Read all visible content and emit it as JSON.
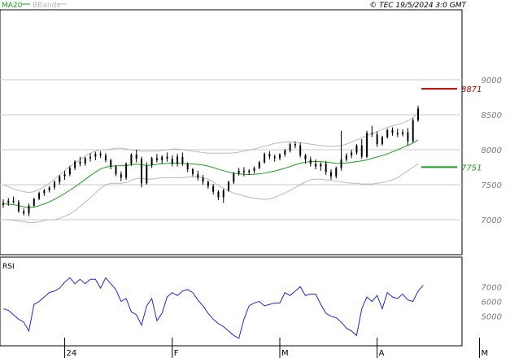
{
  "header": {
    "legend_ma": "MA20",
    "legend_bb": "BBands",
    "copyright": "© TEC 19/5/2024 3:0 GMT"
  },
  "rsi_label": "RSI",
  "colors": {
    "candles": "#000000",
    "ma20": "#1aa01a",
    "bbands": "#b8b8b8",
    "rsi": "#1e28d2",
    "resistance": "#b40000",
    "support": "#1aa01a",
    "grid": "#c8c8c8",
    "axis_text": "#7a7a7a"
  },
  "chart_data": [
    {
      "type": "candlestick",
      "title": "",
      "ylim": [
        6500,
        10000
      ],
      "yticks": [
        7000,
        7500,
        8000,
        8500,
        9000
      ],
      "ytick_labels": [
        "7000",
        "7500",
        "8000",
        "8500",
        "9000"
      ],
      "x_labels": [
        {
          "index": 12,
          "label": "24"
        },
        {
          "index": 33,
          "label": "F"
        },
        {
          "index": 54,
          "label": "M"
        },
        {
          "index": 73,
          "label": "A"
        },
        {
          "index": 93,
          "label": "M"
        }
      ],
      "levels": [
        {
          "name": "resistance",
          "value": 8871,
          "label": "8871"
        },
        {
          "name": "support",
          "value": 7751,
          "label": "7751"
        }
      ],
      "ohlc": [
        [
          7210,
          7290,
          7170,
          7240
        ],
        [
          7240,
          7310,
          7200,
          7270
        ],
        [
          7270,
          7330,
          7230,
          7250
        ],
        [
          7250,
          7280,
          7100,
          7120
        ],
        [
          7120,
          7160,
          7060,
          7090
        ],
        [
          7090,
          7230,
          7050,
          7200
        ],
        [
          7200,
          7310,
          7180,
          7300
        ],
        [
          7300,
          7400,
          7280,
          7380
        ],
        [
          7380,
          7440,
          7340,
          7420
        ],
        [
          7420,
          7480,
          7390,
          7460
        ],
        [
          7460,
          7560,
          7430,
          7540
        ],
        [
          7540,
          7640,
          7500,
          7620
        ],
        [
          7620,
          7700,
          7570,
          7650
        ],
        [
          7650,
          7770,
          7620,
          7740
        ],
        [
          7740,
          7850,
          7710,
          7830
        ],
        [
          7830,
          7900,
          7760,
          7800
        ],
        [
          7800,
          7900,
          7770,
          7880
        ],
        [
          7880,
          7950,
          7830,
          7900
        ],
        [
          7900,
          7970,
          7850,
          7940
        ],
        [
          7940,
          7980,
          7880,
          7920
        ],
        [
          7920,
          7950,
          7820,
          7850
        ],
        [
          7850,
          7870,
          7720,
          7760
        ],
        [
          7760,
          7780,
          7620,
          7650
        ],
        [
          7650,
          7690,
          7550,
          7600
        ],
        [
          7600,
          7820,
          7570,
          7800
        ],
        [
          7800,
          7950,
          7770,
          7930
        ],
        [
          7930,
          8000,
          7820,
          7870
        ],
        [
          7870,
          7900,
          7460,
          7520
        ],
        [
          7520,
          7820,
          7500,
          7780
        ],
        [
          7780,
          7900,
          7740,
          7880
        ],
        [
          7880,
          7940,
          7820,
          7850
        ],
        [
          7850,
          7920,
          7800,
          7900
        ],
        [
          7900,
          7960,
          7830,
          7870
        ],
        [
          7870,
          7920,
          7760,
          7800
        ],
        [
          7800,
          7940,
          7760,
          7900
        ],
        [
          7900,
          7960,
          7770,
          7800
        ],
        [
          7800,
          7820,
          7680,
          7720
        ],
        [
          7720,
          7740,
          7620,
          7650
        ],
        [
          7650,
          7700,
          7560,
          7600
        ],
        [
          7600,
          7640,
          7500,
          7540
        ],
        [
          7540,
          7560,
          7440,
          7480
        ],
        [
          7480,
          7510,
          7360,
          7400
        ],
        [
          7400,
          7420,
          7280,
          7320
        ],
        [
          7320,
          7440,
          7240,
          7420
        ],
        [
          7420,
          7560,
          7400,
          7540
        ],
        [
          7540,
          7680,
          7510,
          7660
        ],
        [
          7660,
          7740,
          7630,
          7700
        ],
        [
          7700,
          7750,
          7620,
          7680
        ],
        [
          7680,
          7720,
          7640,
          7700
        ],
        [
          7700,
          7760,
          7660,
          7740
        ],
        [
          7740,
          7840,
          7720,
          7820
        ],
        [
          7820,
          7960,
          7800,
          7940
        ],
        [
          7940,
          7980,
          7860,
          7900
        ],
        [
          7900,
          7930,
          7830,
          7880
        ],
        [
          7880,
          7950,
          7850,
          7930
        ],
        [
          7930,
          8010,
          7900,
          7990
        ],
        [
          7990,
          8100,
          7960,
          8080
        ],
        [
          8080,
          8120,
          8020,
          8060
        ],
        [
          8060,
          8100,
          7890,
          7920
        ],
        [
          7920,
          7940,
          7800,
          7860
        ],
        [
          7860,
          7900,
          7760,
          7800
        ],
        [
          7800,
          7860,
          7720,
          7760
        ],
        [
          7760,
          7820,
          7700,
          7800
        ],
        [
          7800,
          7840,
          7640,
          7680
        ],
        [
          7680,
          7720,
          7570,
          7620
        ],
        [
          7620,
          7760,
          7590,
          7740
        ],
        [
          7740,
          8270,
          7700,
          7860
        ],
        [
          7860,
          7950,
          7830,
          7920
        ],
        [
          7920,
          8000,
          7880,
          7960
        ],
        [
          7960,
          8080,
          7930,
          8060
        ],
        [
          8060,
          8150,
          7870,
          7900
        ],
        [
          7900,
          8270,
          7880,
          8240
        ],
        [
          8240,
          8340,
          8180,
          8220
        ],
        [
          8220,
          8260,
          8040,
          8080
        ],
        [
          8080,
          8200,
          8060,
          8180
        ],
        [
          8180,
          8300,
          8160,
          8280
        ],
        [
          8280,
          8320,
          8200,
          8240
        ],
        [
          8240,
          8300,
          8180,
          8220
        ],
        [
          8220,
          8290,
          8190,
          8250
        ],
        [
          8250,
          8310,
          8060,
          8120
        ],
        [
          8120,
          8450,
          8100,
          8420
        ],
        [
          8420,
          8630,
          8400,
          8590
        ]
      ],
      "ma20": [
        7230,
        7220,
        7215,
        7200,
        7185,
        7175,
        7180,
        7200,
        7225,
        7255,
        7290,
        7330,
        7375,
        7420,
        7470,
        7520,
        7575,
        7630,
        7680,
        7725,
        7750,
        7765,
        7770,
        7770,
        7775,
        7785,
        7795,
        7785,
        7775,
        7780,
        7790,
        7800,
        7805,
        7808,
        7808,
        7805,
        7800,
        7795,
        7790,
        7780,
        7765,
        7745,
        7720,
        7700,
        7680,
        7665,
        7655,
        7648,
        7645,
        7648,
        7655,
        7665,
        7680,
        7695,
        7715,
        7735,
        7760,
        7785,
        7805,
        7822,
        7832,
        7835,
        7830,
        7822,
        7815,
        7805,
        7805,
        7810,
        7820,
        7830,
        7840,
        7855,
        7875,
        7895,
        7915,
        7940,
        7970,
        8000,
        8030,
        8060,
        8095,
        8140
      ],
      "bb_upper": [
        7500,
        7470,
        7440,
        7420,
        7400,
        7390,
        7400,
        7430,
        7470,
        7520,
        7580,
        7640,
        7700,
        7760,
        7810,
        7860,
        7910,
        7950,
        7980,
        8000,
        8000,
        8010,
        8020,
        8020,
        8010,
        8000,
        7990,
        7980,
        7980,
        7980,
        7980,
        7990,
        8000,
        8010,
        8010,
        8000,
        7990,
        7980,
        7970,
        7960,
        7950,
        7950,
        7950,
        7950,
        7950,
        7955,
        7965,
        7980,
        7995,
        8010,
        8030,
        8050,
        8070,
        8090,
        8100,
        8110,
        8110,
        8105,
        8100,
        8090,
        8080,
        8070,
        8060,
        8050,
        8050,
        8050,
        8060,
        8080,
        8110,
        8140,
        8170,
        8200,
        8230,
        8260,
        8290,
        8320,
        8340,
        8360,
        8380,
        8410,
        8460,
        8530
      ],
      "bb_lower": [
        7000,
        7000,
        6990,
        6980,
        6970,
        6960,
        6960,
        6970,
        6990,
        7000,
        7000,
        7020,
        7050,
        7080,
        7130,
        7190,
        7250,
        7310,
        7380,
        7450,
        7500,
        7520,
        7520,
        7520,
        7530,
        7560,
        7590,
        7590,
        7580,
        7580,
        7590,
        7600,
        7600,
        7600,
        7600,
        7600,
        7610,
        7610,
        7610,
        7600,
        7580,
        7540,
        7490,
        7450,
        7410,
        7380,
        7360,
        7340,
        7320,
        7310,
        7300,
        7290,
        7300,
        7320,
        7350,
        7380,
        7420,
        7460,
        7500,
        7540,
        7570,
        7580,
        7580,
        7570,
        7560,
        7550,
        7540,
        7530,
        7520,
        7520,
        7510,
        7510,
        7510,
        7520,
        7530,
        7550,
        7570,
        7600,
        7650,
        7700,
        7750,
        7800
      ],
      "series": [
        {
          "name": "MA20"
        },
        {
          "name": "BBands"
        }
      ]
    },
    {
      "type": "line",
      "title": "RSI",
      "ylim": [
        30,
        90
      ],
      "yticks": [
        50,
        60,
        70
      ],
      "ytick_labels": [
        "5000",
        "6000",
        "7000"
      ],
      "values": [
        55,
        54,
        51,
        48,
        46,
        40,
        58,
        60,
        63,
        66,
        67,
        69,
        73,
        76,
        72,
        75,
        72,
        75,
        75,
        69,
        76,
        72,
        68,
        60,
        62,
        53,
        51,
        44,
        57,
        62,
        47,
        52,
        63,
        66,
        64,
        67,
        68,
        66,
        61,
        57,
        52,
        48,
        45,
        43,
        40,
        37,
        35,
        48,
        57,
        59,
        60,
        57,
        58,
        59,
        59,
        66,
        64,
        67,
        70,
        64,
        65,
        65,
        58,
        52,
        50,
        49,
        46,
        42,
        40,
        37,
        55,
        63,
        60,
        64,
        55,
        66,
        63,
        62,
        65,
        61,
        60,
        67,
        71
      ]
    }
  ]
}
